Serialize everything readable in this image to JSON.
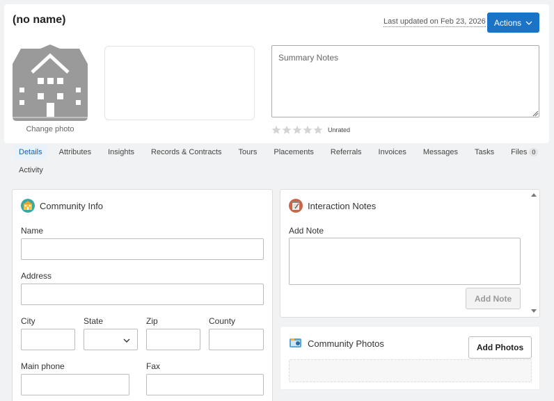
{
  "header": {
    "title": "(no name)",
    "last_updated": "Last updated on Feb 23, 2026",
    "actions_label": "Actions"
  },
  "profile": {
    "change_photo": "Change photo",
    "summary_placeholder": "Summary Notes",
    "rating_label": "Unrated",
    "rating_value": 0,
    "rating_max": 5
  },
  "tabs": [
    {
      "label": "Details",
      "active": true
    },
    {
      "label": "Attributes"
    },
    {
      "label": "Insights"
    },
    {
      "label": "Records & Contracts"
    },
    {
      "label": "Tours"
    },
    {
      "label": "Placements"
    },
    {
      "label": "Referrals"
    },
    {
      "label": "Invoices"
    },
    {
      "label": "Messages"
    },
    {
      "label": "Tasks"
    },
    {
      "label": "Files",
      "badge": "0"
    }
  ],
  "tabs_row2": [
    {
      "label": "Activity"
    }
  ],
  "community_info": {
    "title": "Community Info",
    "name_label": "Name",
    "address_label": "Address",
    "city_label": "City",
    "state_label": "State",
    "zip_label": "Zip",
    "county_label": "County",
    "main_phone_label": "Main phone",
    "fax_label": "Fax"
  },
  "interaction_notes": {
    "title": "Interaction Notes",
    "add_note_label": "Add Note",
    "add_note_button": "Add Note"
  },
  "community_photos": {
    "title": "Community Photos",
    "add_photos_button": "Add Photos"
  },
  "colors": {
    "accent": "#1a73c5",
    "house_icon": "#9a9a9a",
    "star_empty": "#d4d4d4"
  }
}
